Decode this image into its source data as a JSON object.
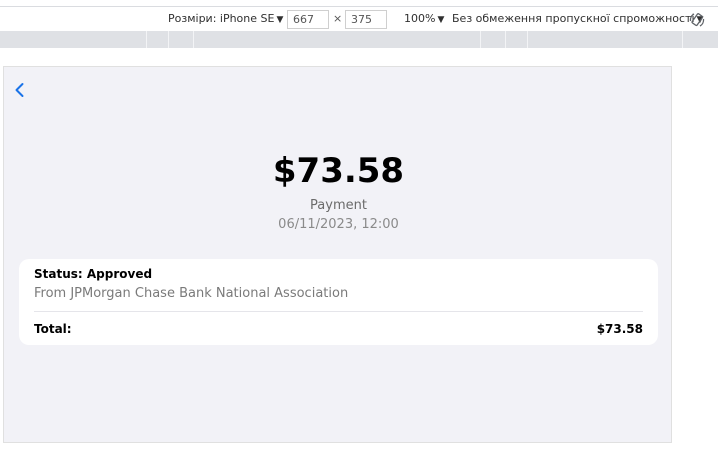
{
  "toolbar": {
    "dimensions_label": "Розміри: iPhone SE",
    "width": "667",
    "times": "×",
    "height": "375",
    "zoom": "100%",
    "throttling": "Без обмеження пропускної спроможності",
    "caret": "▼"
  },
  "screen": {
    "amount": "$73.58",
    "payment_type": "Payment",
    "date": "06/11/2023, 12:00",
    "status": "Status: Approved",
    "from": "From JPMorgan Chase Bank National Association",
    "total_label": "Total:",
    "total_value": "$73.58"
  },
  "colors": {
    "accent": "#1a73e8",
    "screen_background": "#f2f2f7",
    "card_background": "#ffffff"
  },
  "icons": {
    "back": "chevron-left-icon",
    "rotate": "rotate-icon"
  }
}
